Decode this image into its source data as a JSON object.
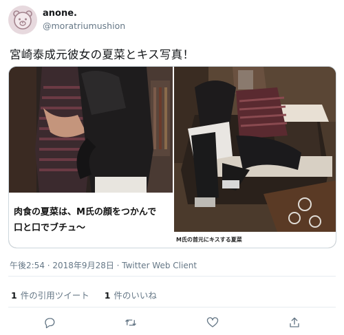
{
  "user": {
    "display_name": "anone.",
    "handle": "@moratriumushion",
    "avatar_icon": "bear-face-icon"
  },
  "tweet": {
    "text": "宮崎泰成元彼女の夏菜とキス写真！"
  },
  "media": {
    "left_caption_line1": "肉食の夏菜は、M氏の顔をつかんで",
    "left_caption_line2": "口と口でブチュ〜",
    "right_caption": "M氏の首元にキスする夏菜"
  },
  "meta": {
    "timestamp": "午後2:54 · 2018年9月28日 · Twitter Web Client"
  },
  "stats": {
    "retweets_count": "1",
    "retweets_label": "件の引用ツイート",
    "likes_count": "1",
    "likes_label": "件のいいね"
  },
  "colors": {
    "text": "#14171a",
    "secondary": "#657786",
    "divider": "#e6ecf0",
    "icon": "#657786"
  },
  "actions": [
    "reply-icon",
    "retweet-icon",
    "like-icon",
    "share-icon"
  ]
}
